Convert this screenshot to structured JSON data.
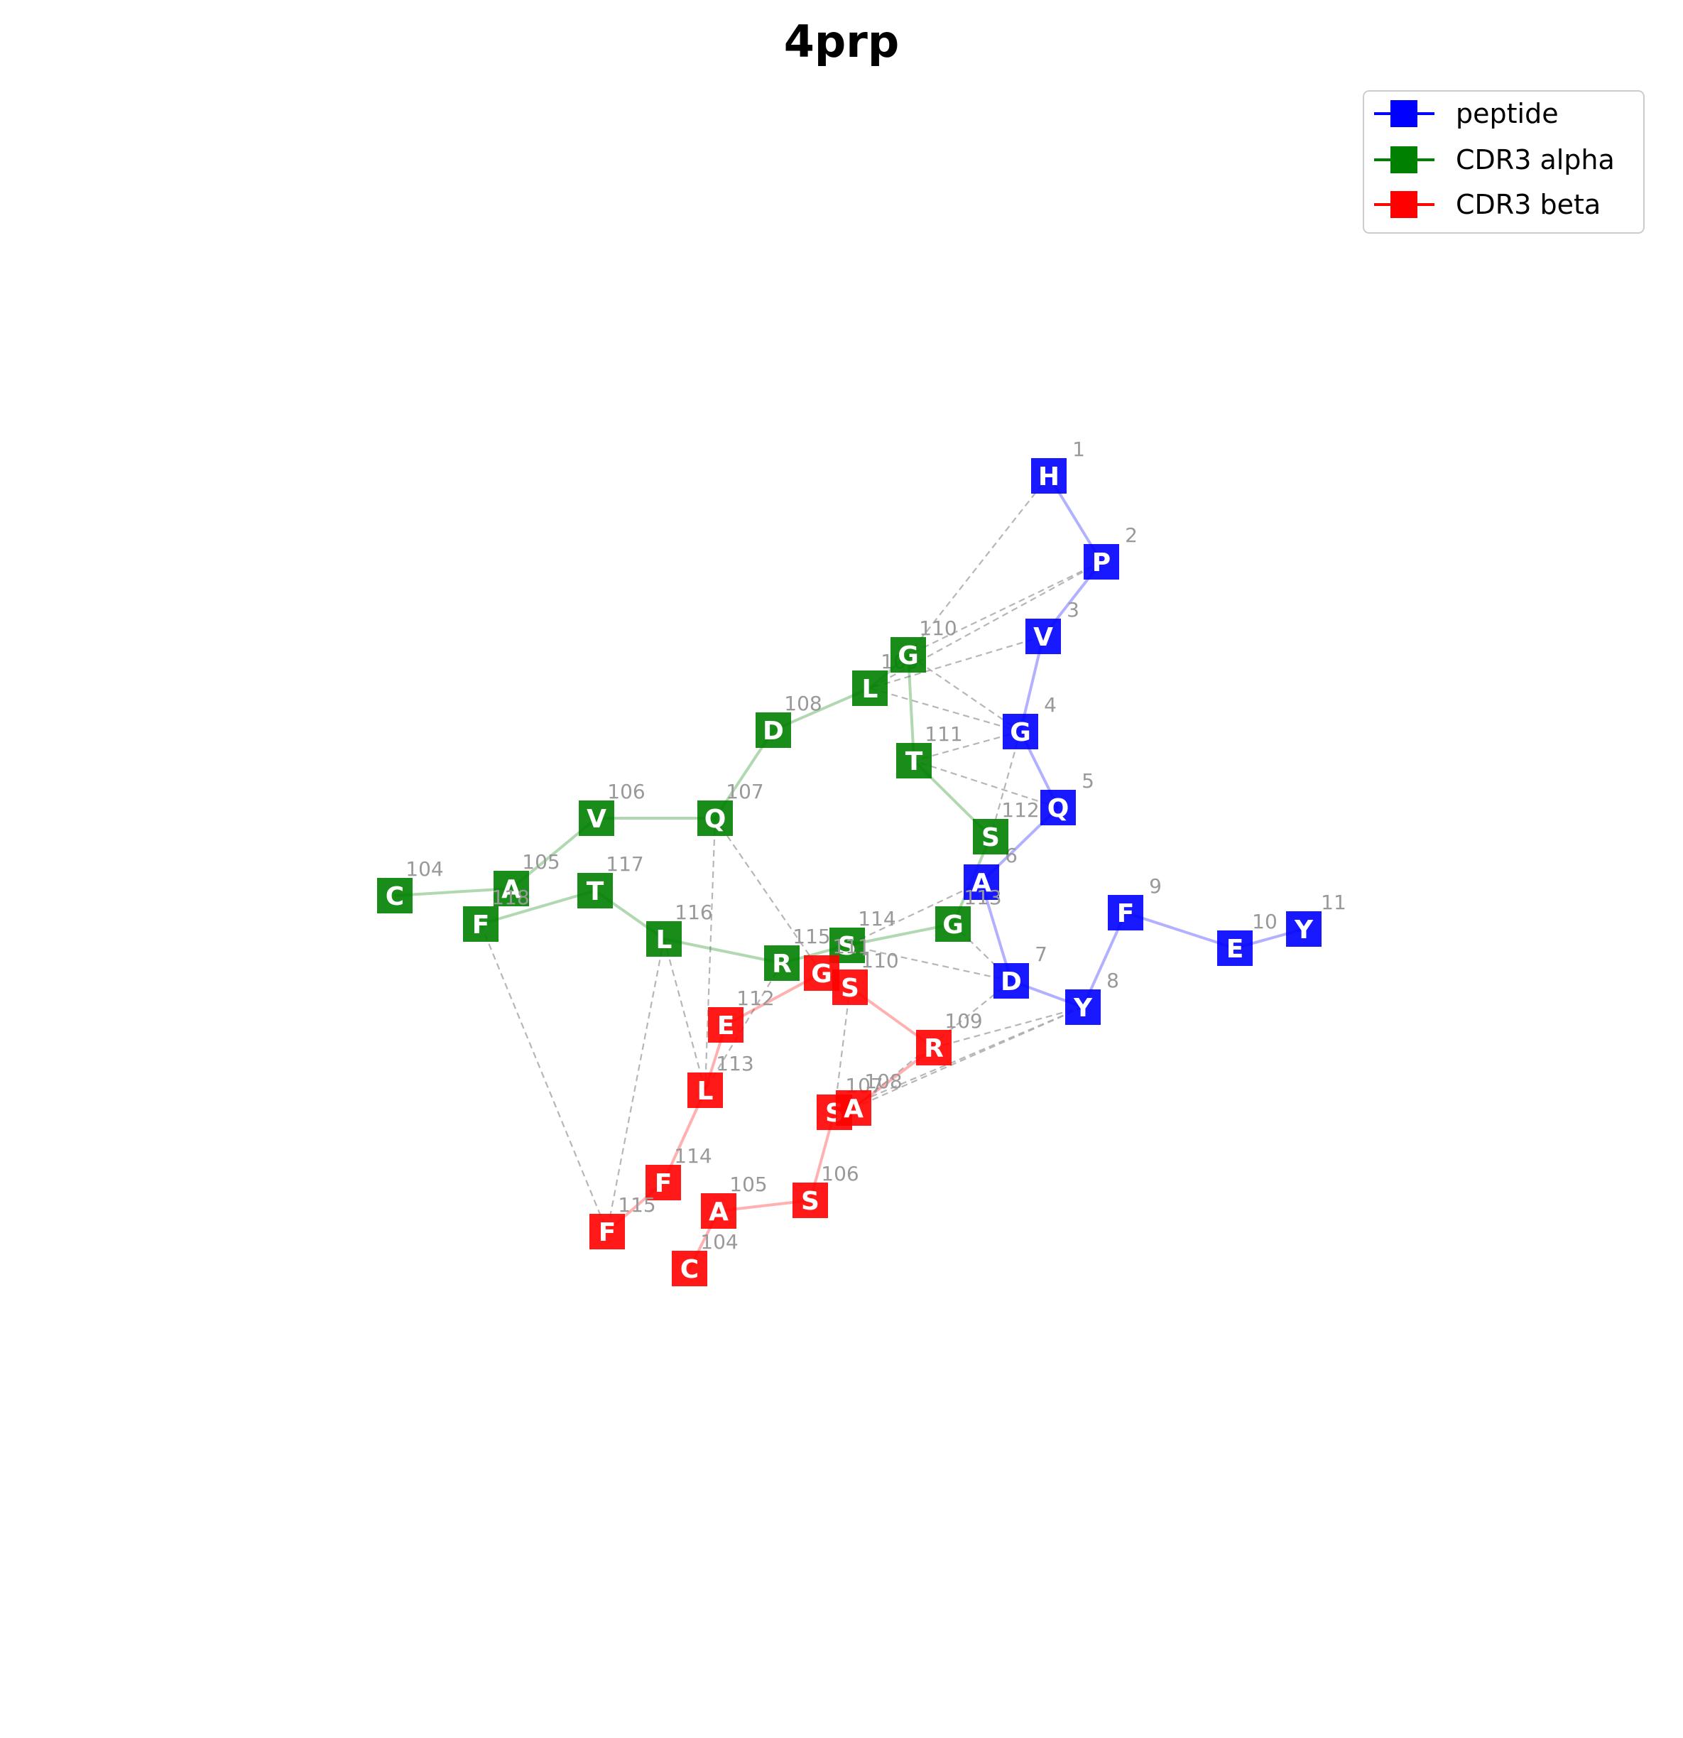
{
  "title": "4prp",
  "legend": [
    {
      "label": "peptide",
      "color": "#0000ff"
    },
    {
      "label": "CDR3 alpha",
      "color": "#008000"
    },
    {
      "label": "CDR3 beta",
      "color": "#ff0000"
    }
  ],
  "chains": {
    "peptide": {
      "color": "#0000ff"
    },
    "alpha": {
      "color": "#008000"
    },
    "beta": {
      "color": "#ff0000"
    }
  },
  "residues": {
    "peptide": [
      {
        "num": "1",
        "aa": "H"
      },
      {
        "num": "2",
        "aa": "P"
      },
      {
        "num": "3",
        "aa": "V"
      },
      {
        "num": "4",
        "aa": "G"
      },
      {
        "num": "5",
        "aa": "Q"
      },
      {
        "num": "6",
        "aa": "A"
      },
      {
        "num": "7",
        "aa": "D"
      },
      {
        "num": "8",
        "aa": "Y"
      },
      {
        "num": "9",
        "aa": "F"
      },
      {
        "num": "10",
        "aa": "E"
      },
      {
        "num": "11",
        "aa": "Y"
      }
    ],
    "alpha": [
      {
        "num": "104",
        "aa": "C"
      },
      {
        "num": "105",
        "aa": "A"
      },
      {
        "num": "106",
        "aa": "V"
      },
      {
        "num": "107",
        "aa": "Q"
      },
      {
        "num": "108",
        "aa": "D"
      },
      {
        "num": "109",
        "aa": "L"
      },
      {
        "num": "110",
        "aa": "G"
      },
      {
        "num": "111",
        "aa": "T"
      },
      {
        "num": "112",
        "aa": "S"
      },
      {
        "num": "113",
        "aa": "G"
      },
      {
        "num": "114",
        "aa": "S"
      },
      {
        "num": "115",
        "aa": "R"
      },
      {
        "num": "116",
        "aa": "L"
      },
      {
        "num": "117",
        "aa": "T"
      },
      {
        "num": "118",
        "aa": "F"
      }
    ],
    "beta": [
      {
        "num": "104",
        "aa": "C"
      },
      {
        "num": "105",
        "aa": "A"
      },
      {
        "num": "106",
        "aa": "S"
      },
      {
        "num": "107",
        "aa": "S"
      },
      {
        "num": "108",
        "aa": "A"
      },
      {
        "num": "109",
        "aa": "R"
      },
      {
        "num": "110",
        "aa": "S"
      },
      {
        "num": "111",
        "aa": "G"
      },
      {
        "num": "112",
        "aa": "E"
      },
      {
        "num": "113",
        "aa": "L"
      },
      {
        "num": "114",
        "aa": "F"
      },
      {
        "num": "115",
        "aa": "F"
      }
    ]
  },
  "contacts": [
    [
      "peptide:1",
      "alpha:110"
    ],
    [
      "peptide:2",
      "alpha:110"
    ],
    [
      "peptide:2",
      "alpha:109"
    ],
    [
      "peptide:3",
      "alpha:109"
    ],
    [
      "peptide:4",
      "alpha:110"
    ],
    [
      "peptide:4",
      "alpha:109"
    ],
    [
      "peptide:4",
      "alpha:111"
    ],
    [
      "peptide:5",
      "alpha:111"
    ],
    [
      "peptide:4",
      "alpha:112"
    ],
    [
      "peptide:6",
      "alpha:114"
    ],
    [
      "peptide:7",
      "alpha:113"
    ],
    [
      "peptide:7",
      "alpha:114"
    ],
    [
      "alpha:107",
      "beta:113"
    ],
    [
      "alpha:107",
      "beta:111"
    ],
    [
      "alpha:118",
      "beta:115"
    ],
    [
      "alpha:116",
      "beta:115"
    ],
    [
      "alpha:116",
      "beta:113"
    ],
    [
      "alpha:115",
      "beta:113"
    ],
    [
      "peptide:7",
      "beta:108"
    ],
    [
      "peptide:8",
      "beta:108"
    ],
    [
      "peptide:8",
      "beta:107"
    ],
    [
      "peptide:8",
      "beta:109"
    ],
    [
      "beta:110",
      "beta:107"
    ]
  ]
}
